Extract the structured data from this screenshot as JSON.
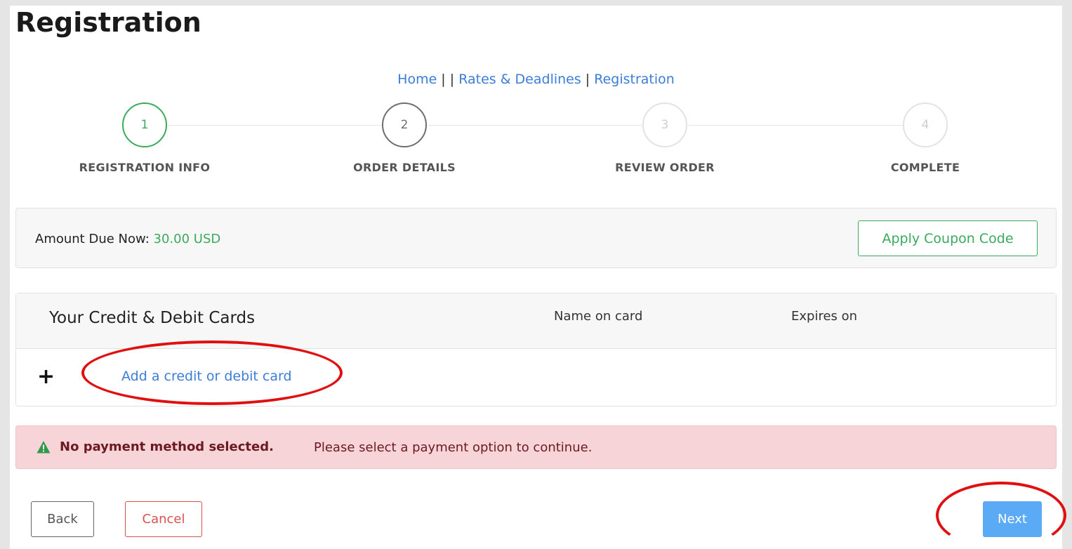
{
  "page": {
    "title": "Registration"
  },
  "breadcrumb": {
    "home": "Home",
    "sep1": " | | ",
    "rates": "Rates & Deadlines",
    "sep2": " | ",
    "registration": "Registration"
  },
  "steps": [
    {
      "number": "1",
      "label": "REGISTRATION INFO",
      "state": "done"
    },
    {
      "number": "2",
      "label": "ORDER DETAILS",
      "state": "active"
    },
    {
      "number": "3",
      "label": "REVIEW ORDER",
      "state": "todo"
    },
    {
      "number": "4",
      "label": "COMPLETE",
      "state": "todo"
    }
  ],
  "amount": {
    "label": "Amount Due Now: ",
    "value": "30.00 USD",
    "coupon_button": "Apply Coupon Code"
  },
  "cards": {
    "title": "Your Credit & Debit Cards",
    "col_name": "Name on card",
    "col_expires": "Expires on",
    "add_icon": "+",
    "add_link": "Add a credit or debit card"
  },
  "alert": {
    "icon": "warning-triangle-icon",
    "strong": "No payment method selected.",
    "text": "Please select a payment option to continue."
  },
  "buttons": {
    "back": "Back",
    "cancel": "Cancel",
    "next": "Next"
  },
  "colors": {
    "green": "#3aaa5c",
    "link_blue": "#3b7dd8",
    "next_blue": "#5aaaf5",
    "cancel_red": "#d9534f",
    "alert_bg": "#f7d4d8",
    "annotation_red": "#e01010"
  }
}
